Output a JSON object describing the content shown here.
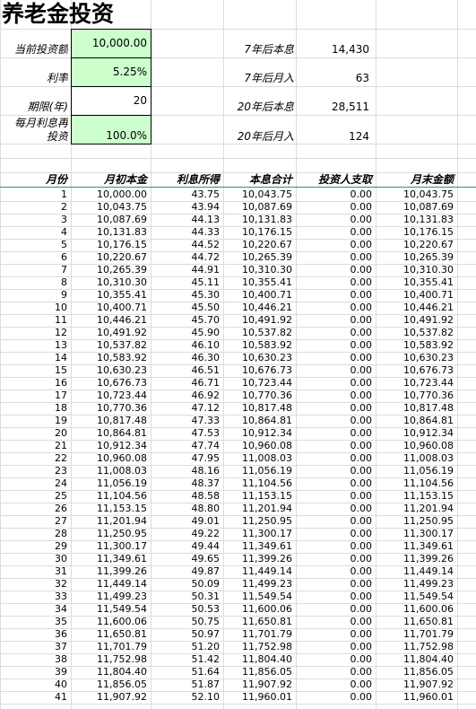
{
  "title": "养老金投资",
  "inputs": {
    "principal_label": "当前投资额",
    "principal_value": "10,000.00",
    "rate_label": "利率",
    "rate_value": "5.25%",
    "years_label": "期限(年)",
    "years_value": "20",
    "reinvest_label_line1": "每月利息再",
    "reinvest_label_line2": "投资",
    "reinvest_value": "100.0%"
  },
  "summary": {
    "total_7_label": "7年后本息",
    "total_7_value": "14,430",
    "monthly_7_label": "7年后月入",
    "monthly_7_value": "63",
    "total_20_label": "20年后本息",
    "total_20_value": "28,511",
    "monthly_20_label": "20年后月入",
    "monthly_20_value": "124"
  },
  "table": {
    "headers": [
      "月份",
      "月初本金",
      "利息所得",
      "本息合计",
      "投资人支取",
      "月末金额"
    ],
    "rows": [
      [
        "1",
        "10,000.00",
        "43.75",
        "10,043.75",
        "0.00",
        "10,043.75"
      ],
      [
        "2",
        "10,043.75",
        "43.94",
        "10,087.69",
        "0.00",
        "10,087.69"
      ],
      [
        "3",
        "10,087.69",
        "44.13",
        "10,131.83",
        "0.00",
        "10,131.83"
      ],
      [
        "4",
        "10,131.83",
        "44.33",
        "10,176.15",
        "0.00",
        "10,176.15"
      ],
      [
        "5",
        "10,176.15",
        "44.52",
        "10,220.67",
        "0.00",
        "10,220.67"
      ],
      [
        "6",
        "10,220.67",
        "44.72",
        "10,265.39",
        "0.00",
        "10,265.39"
      ],
      [
        "7",
        "10,265.39",
        "44.91",
        "10,310.30",
        "0.00",
        "10,310.30"
      ],
      [
        "8",
        "10,310.30",
        "45.11",
        "10,355.41",
        "0.00",
        "10,355.41"
      ],
      [
        "9",
        "10,355.41",
        "45.30",
        "10,400.71",
        "0.00",
        "10,400.71"
      ],
      [
        "10",
        "10,400.71",
        "45.50",
        "10,446.21",
        "0.00",
        "10,446.21"
      ],
      [
        "11",
        "10,446.21",
        "45.70",
        "10,491.92",
        "0.00",
        "10,491.92"
      ],
      [
        "12",
        "10,491.92",
        "45.90",
        "10,537.82",
        "0.00",
        "10,537.82"
      ],
      [
        "13",
        "10,537.82",
        "46.10",
        "10,583.92",
        "0.00",
        "10,583.92"
      ],
      [
        "14",
        "10,583.92",
        "46.30",
        "10,630.23",
        "0.00",
        "10,630.23"
      ],
      [
        "15",
        "10,630.23",
        "46.51",
        "10,676.73",
        "0.00",
        "10,676.73"
      ],
      [
        "16",
        "10,676.73",
        "46.71",
        "10,723.44",
        "0.00",
        "10,723.44"
      ],
      [
        "17",
        "10,723.44",
        "46.92",
        "10,770.36",
        "0.00",
        "10,770.36"
      ],
      [
        "18",
        "10,770.36",
        "47.12",
        "10,817.48",
        "0.00",
        "10,817.48"
      ],
      [
        "19",
        "10,817.48",
        "47.33",
        "10,864.81",
        "0.00",
        "10,864.81"
      ],
      [
        "20",
        "10,864.81",
        "47.53",
        "10,912.34",
        "0.00",
        "10,912.34"
      ],
      [
        "21",
        "10,912.34",
        "47.74",
        "10,960.08",
        "0.00",
        "10,960.08"
      ],
      [
        "22",
        "10,960.08",
        "47.95",
        "11,008.03",
        "0.00",
        "11,008.03"
      ],
      [
        "23",
        "11,008.03",
        "48.16",
        "11,056.19",
        "0.00",
        "11,056.19"
      ],
      [
        "24",
        "11,056.19",
        "48.37",
        "11,104.56",
        "0.00",
        "11,104.56"
      ],
      [
        "25",
        "11,104.56",
        "48.58",
        "11,153.15",
        "0.00",
        "11,153.15"
      ],
      [
        "26",
        "11,153.15",
        "48.80",
        "11,201.94",
        "0.00",
        "11,201.94"
      ],
      [
        "27",
        "11,201.94",
        "49.01",
        "11,250.95",
        "0.00",
        "11,250.95"
      ],
      [
        "28",
        "11,250.95",
        "49.22",
        "11,300.17",
        "0.00",
        "11,300.17"
      ],
      [
        "29",
        "11,300.17",
        "49.44",
        "11,349.61",
        "0.00",
        "11,349.61"
      ],
      [
        "30",
        "11,349.61",
        "49.65",
        "11,399.26",
        "0.00",
        "11,399.26"
      ],
      [
        "31",
        "11,399.26",
        "49.87",
        "11,449.14",
        "0.00",
        "11,449.14"
      ],
      [
        "32",
        "11,449.14",
        "50.09",
        "11,499.23",
        "0.00",
        "11,499.23"
      ],
      [
        "33",
        "11,499.23",
        "50.31",
        "11,549.54",
        "0.00",
        "11,549.54"
      ],
      [
        "34",
        "11,549.54",
        "50.53",
        "11,600.06",
        "0.00",
        "11,600.06"
      ],
      [
        "35",
        "11,600.06",
        "50.75",
        "11,650.81",
        "0.00",
        "11,650.81"
      ],
      [
        "36",
        "11,650.81",
        "50.97",
        "11,701.79",
        "0.00",
        "11,701.79"
      ],
      [
        "37",
        "11,701.79",
        "51.20",
        "11,752.98",
        "0.00",
        "11,752.98"
      ],
      [
        "38",
        "11,752.98",
        "51.42",
        "11,804.40",
        "0.00",
        "11,804.40"
      ],
      [
        "39",
        "11,804.40",
        "51.64",
        "11,856.05",
        "0.00",
        "11,856.05"
      ],
      [
        "40",
        "11,856.05",
        "51.87",
        "11,907.92",
        "0.00",
        "11,907.92"
      ],
      [
        "41",
        "11,907.92",
        "52.10",
        "11,960.01",
        "0.00",
        "11,960.01"
      ]
    ]
  },
  "colors": {
    "input_fill": "#ccffcc",
    "gridline": "#dcdcdc",
    "header_rule": "#2a8f8f"
  }
}
